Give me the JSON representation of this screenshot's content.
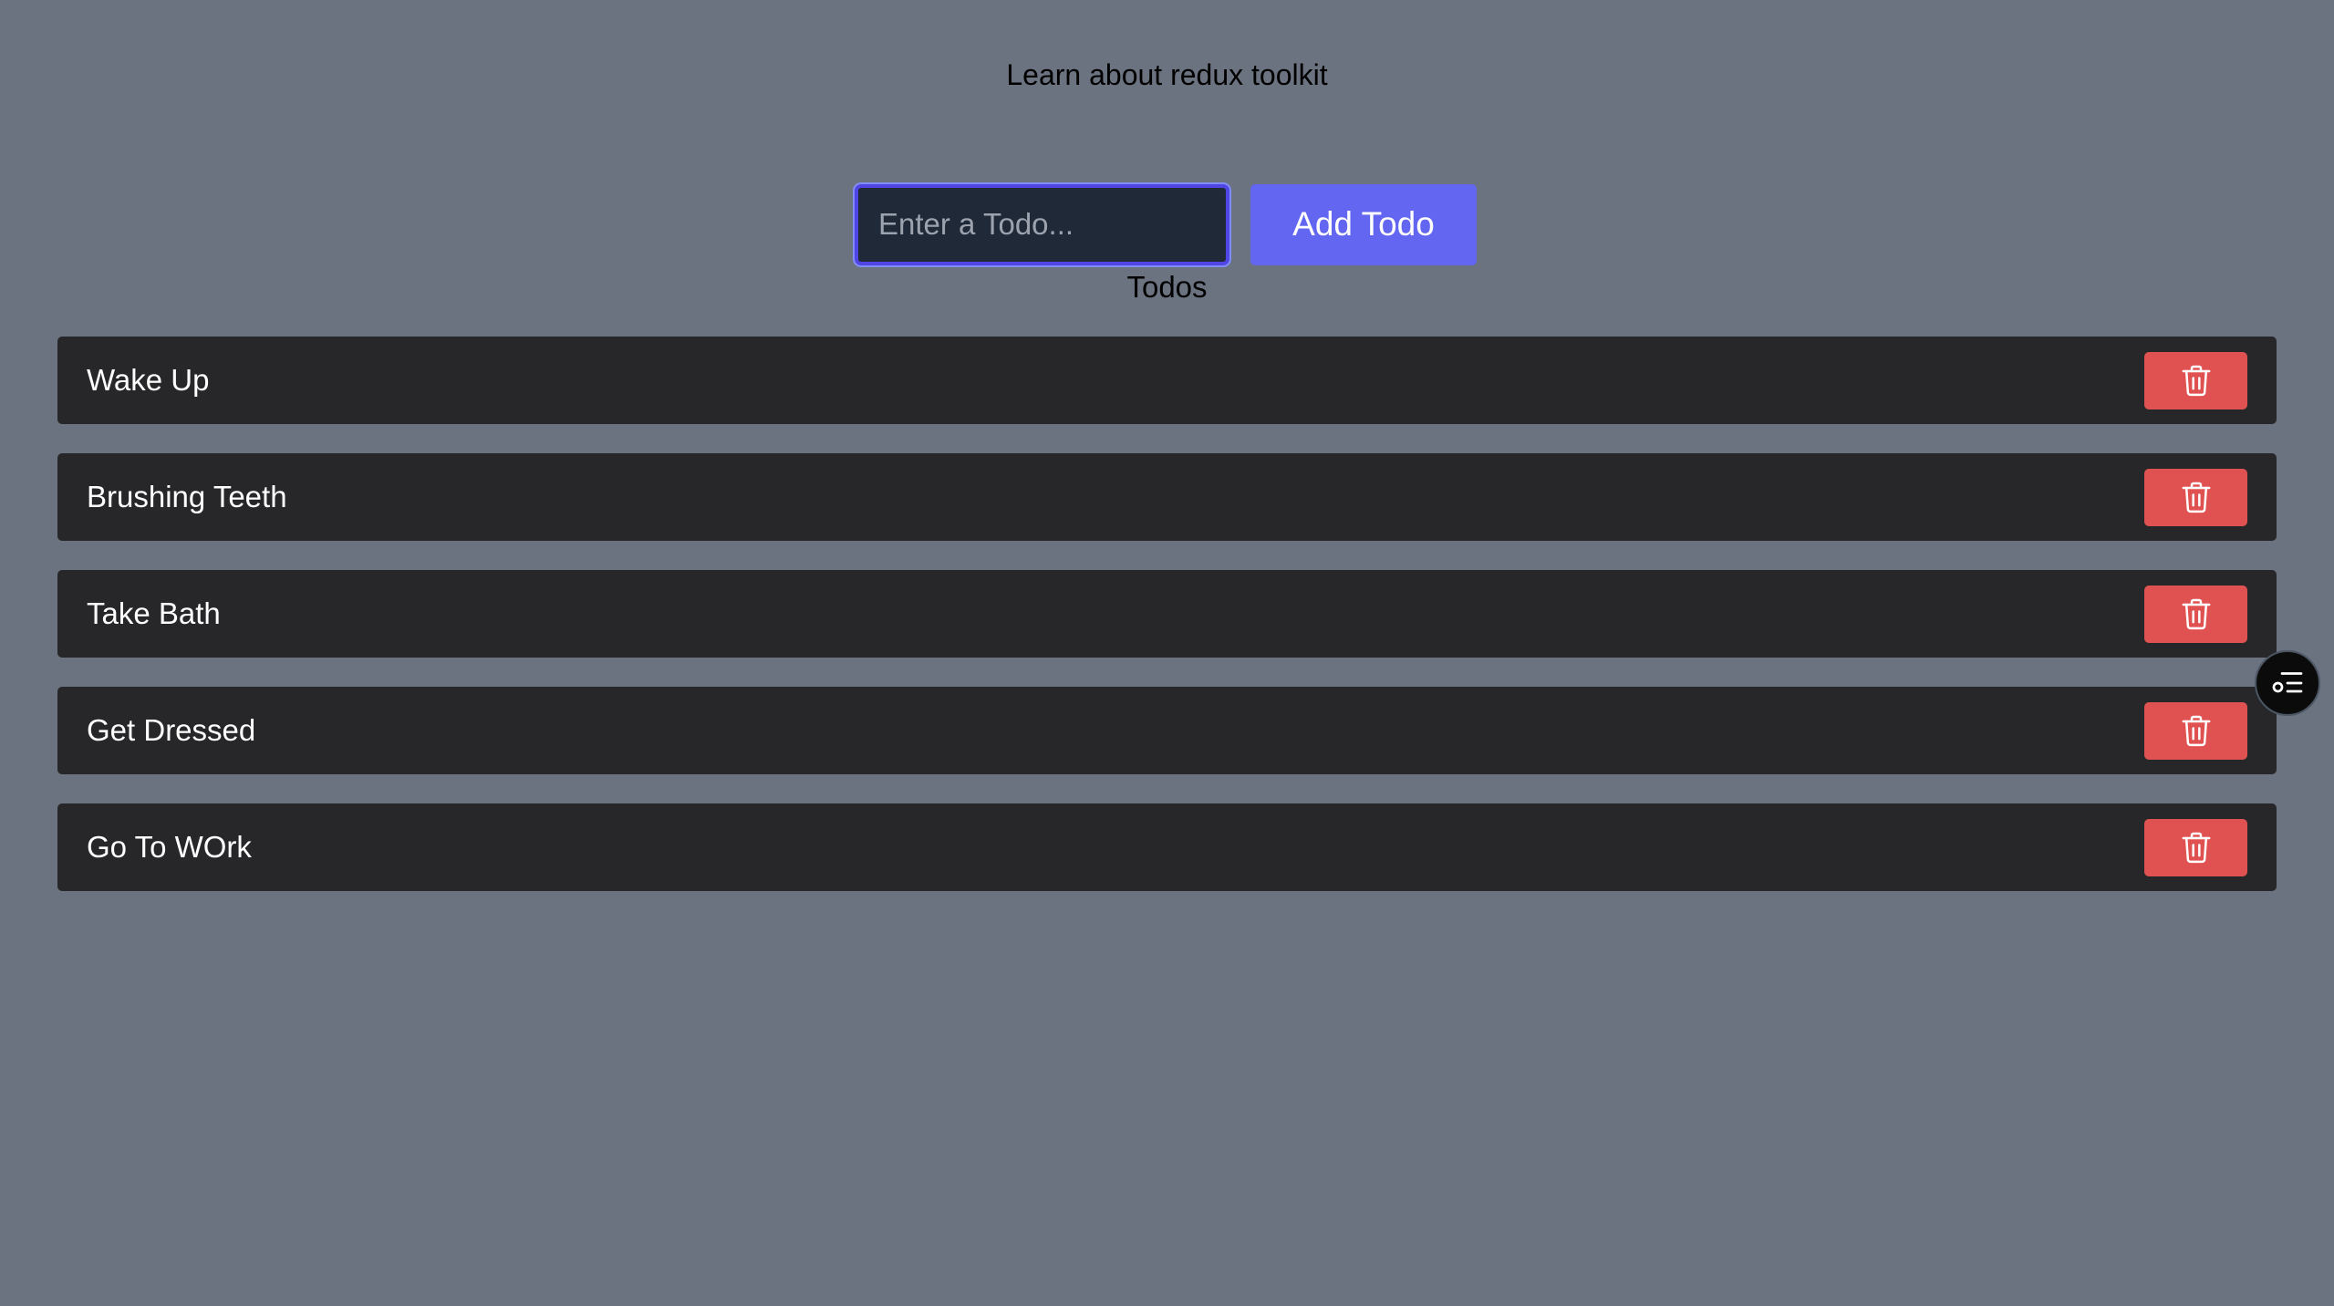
{
  "header": {
    "title": "Learn about redux toolkit"
  },
  "form": {
    "input_placeholder": "Enter a Todo...",
    "input_value": "",
    "add_button_label": "Add Todo"
  },
  "list": {
    "heading": "Todos",
    "items": [
      {
        "text": "Wake Up",
        "delete_icon": "trash-icon"
      },
      {
        "text": "Brushing Teeth",
        "delete_icon": "trash-icon"
      },
      {
        "text": "Take Bath",
        "delete_icon": "trash-icon"
      },
      {
        "text": "Get Dressed",
        "delete_icon": "trash-icon"
      },
      {
        "text": "Go To WOrk",
        "delete_icon": "trash-icon"
      }
    ]
  },
  "floating": {
    "icon": "devtools-toggle-icon"
  },
  "colors": {
    "background": "#6b7280",
    "item_background": "#27272a",
    "accent": "#6366f1",
    "input_border": "#4f46e5",
    "delete": "#e05252"
  }
}
